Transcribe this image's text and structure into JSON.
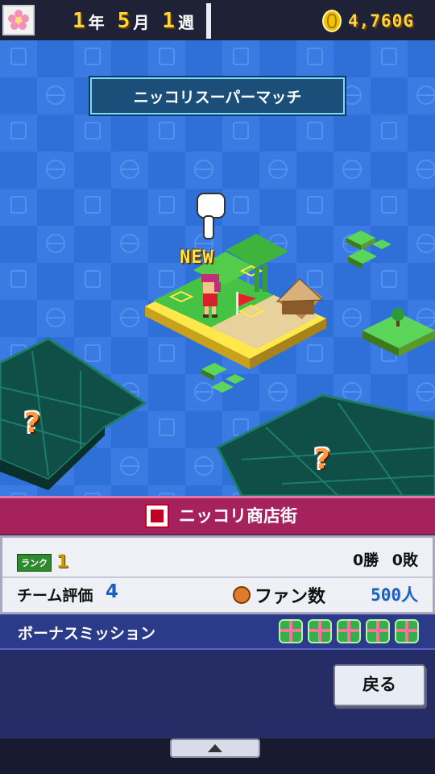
{
  "header": {
    "year": "1",
    "year_unit": "年",
    "month": "5",
    "month_unit": "月",
    "week": "1",
    "week_unit": "週",
    "money": "4,760G"
  },
  "map": {
    "area_title": "ニッコリスーパーマッチ",
    "new_label": "NEW",
    "unknown_marker": "?"
  },
  "location": {
    "name": "ニッコリ商店街",
    "rank_badge": "ランク",
    "rank": "1",
    "record": "0勝 0敗",
    "team_rating_label": "チーム評価",
    "team_rating": "4",
    "fan_label": "ファン数",
    "fans": "500人"
  },
  "bonus": {
    "label": "ボーナスミッション",
    "gift_count": 5
  },
  "buttons": {
    "back": "戻る"
  },
  "icons": [
    "flower-icon",
    "coin-icon",
    "pointing-hand-icon",
    "shop-icon",
    "fan-icon",
    "gift-icon",
    "up-arrow-icon"
  ],
  "colors": {
    "map_background": "#2f6fd8",
    "header_magenta": "#a6225d",
    "bonus_blue": "#2c3a8a",
    "gold_text": "#ffd43a"
  }
}
